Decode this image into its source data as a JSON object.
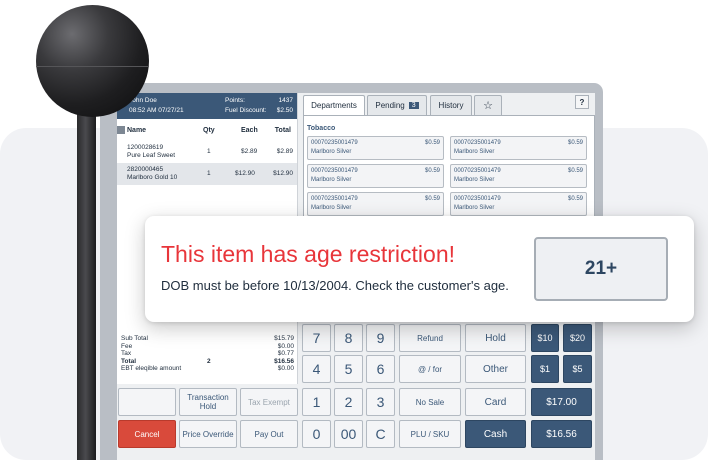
{
  "customer": {
    "name": "John Doe",
    "datetime": "08:52 AM 07/27/21",
    "points_label": "Points:",
    "points_value": "1437",
    "fuel_label": "Fuel Discount:",
    "fuel_value": "$2.50"
  },
  "ticket": {
    "headers": {
      "name": "Name",
      "qty": "Qty",
      "each": "Each",
      "total": "Total"
    },
    "lines": [
      {
        "code": "1200028619",
        "name": "Pure Leaf Sweet",
        "qty": "1",
        "each": "$2.89",
        "total": "$2.89"
      },
      {
        "code": "2820000465",
        "name": "Marlboro Gold 10",
        "qty": "1",
        "each": "$12.90",
        "total": "$12.90"
      }
    ],
    "totals": {
      "subtotal_label": "Sub Total",
      "subtotal": "$15.79",
      "fee_label": "Fee",
      "fee": "$0.00",
      "tax_label": "Tax",
      "tax": "$0.77",
      "total_label": "Total",
      "total_qty": "2",
      "total": "$16.56",
      "ebt_label": "EBT eleqible amount",
      "ebt": "$0.00"
    }
  },
  "tabs": {
    "departments": "Departments",
    "pending": "Pending",
    "pending_count": "3",
    "history": "History",
    "favorites_icon": "☆",
    "help": "?"
  },
  "department": {
    "title": "Tobacco",
    "items": [
      {
        "code": "00070235001479",
        "price": "$0.59",
        "name": "Marlboro Silver"
      },
      {
        "code": "00070235001479",
        "price": "$0.59",
        "name": "Marlboro Silver"
      },
      {
        "code": "00070235001479",
        "price": "$0.59",
        "name": "Marlboro Silver"
      },
      {
        "code": "00070235001479",
        "price": "$0.59",
        "name": "Marlboro Silver"
      },
      {
        "code": "00070235001479",
        "price": "$0.59",
        "name": "Marlboro Silver"
      },
      {
        "code": "00070235001479",
        "price": "$0.59",
        "name": "Marlboro Silver"
      }
    ]
  },
  "keypad": {
    "digits": [
      "7",
      "8",
      "9",
      "4",
      "5",
      "6",
      "1",
      "2",
      "3",
      "0",
      "00",
      "C"
    ],
    "refund": "Refund",
    "at_for": "@ / for",
    "no_sale": "No Sale",
    "plu_sku": "PLU / SKU",
    "hold": "Hold",
    "other": "Other",
    "card": "Card",
    "cash": "Cash",
    "q10": "$10",
    "q20": "$20",
    "q1": "$1",
    "q5": "$5",
    "q17": "$17.00",
    "q16": "$16.56"
  },
  "actions": {
    "transaction_hold": "Transaction Hold",
    "tax_exempt": "Tax Exempt",
    "cancel": "Cancel",
    "price_override": "Price Override",
    "pay_out": "Pay Out"
  },
  "popup": {
    "title": "This item has age restriction!",
    "message": "DOB must be before 10/13/2004. Check the customer's age.",
    "age_button": "21+"
  },
  "colors": {
    "accent": "#3b5878",
    "alert_red": "#e8353a",
    "cancel_red": "#d94a3b"
  }
}
